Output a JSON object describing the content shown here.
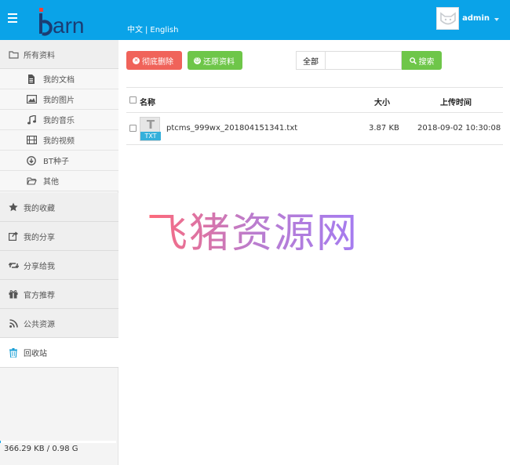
{
  "header": {
    "logo_text": "iBarn",
    "lang": {
      "zh": "中文",
      "separator": "|",
      "en": "English"
    },
    "user": {
      "name": "admin"
    },
    "colors": {
      "brand": "#0aa3e8"
    }
  },
  "sidebar": {
    "all_files": {
      "label": "所有资料",
      "icon": "folder-icon"
    },
    "categories": [
      {
        "label": "我的文档",
        "icon": "document-icon"
      },
      {
        "label": "我的图片",
        "icon": "image-icon"
      },
      {
        "label": "我的音乐",
        "icon": "music-icon"
      },
      {
        "label": "我的视频",
        "icon": "film-icon"
      },
      {
        "label": "BT种子",
        "icon": "download-icon"
      },
      {
        "label": "其他",
        "icon": "folder-open-icon"
      }
    ],
    "sections": [
      {
        "label": "我的收藏",
        "icon": "star-icon"
      },
      {
        "label": "我的分享",
        "icon": "share-icon"
      },
      {
        "label": "分享给我",
        "icon": "retweet-icon"
      },
      {
        "label": "官方推荐",
        "icon": "gift-icon"
      },
      {
        "label": "公共资源",
        "icon": "rss-icon"
      },
      {
        "label": "回收站",
        "icon": "trash-icon",
        "active": true
      }
    ],
    "quota": {
      "text": "366.29 KB / 0.98 G",
      "used_fraction": 0.0004
    }
  },
  "toolbar": {
    "delete_label": "彻底删除",
    "restore_label": "还原资料",
    "search_scope": "全部",
    "search_placeholder": "",
    "search_label": "搜索",
    "colors": {
      "delete": "#f0635a",
      "restore": "#6ec649"
    }
  },
  "list": {
    "headers": {
      "name": "名称",
      "size": "大小",
      "time": "上传时间"
    },
    "rows": [
      {
        "file_type": "TXT",
        "icon_letter": "T",
        "name": "ptcms_999wx_201804151341.txt",
        "size": "3.87 KB",
        "time": "2018-09-02 10:30:08"
      }
    ]
  },
  "watermark": "飞猪资源网"
}
